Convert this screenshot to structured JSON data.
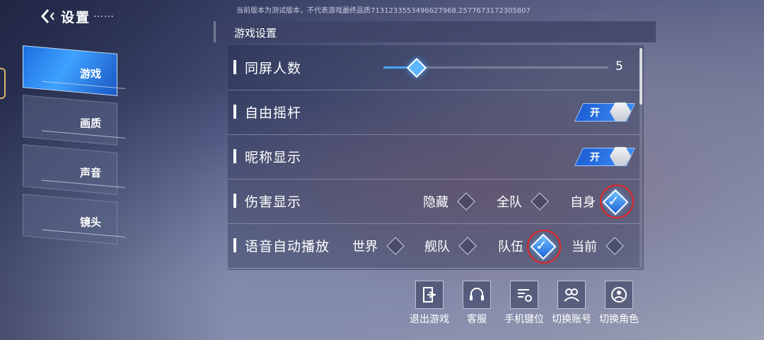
{
  "header": {
    "title": "设置",
    "dots": "……",
    "version_notice": "当前版本为测试版本，不代表游戏最终品质7131233553496627968.2577673172305807"
  },
  "tabs": [
    {
      "label": "游戏",
      "active": true
    },
    {
      "label": "画质",
      "active": false
    },
    {
      "label": "声音",
      "active": false
    },
    {
      "label": "镜头",
      "active": false
    }
  ],
  "section_title": "游戏设置",
  "settings": {
    "screen_people": {
      "label": "同屏人数",
      "value": "5",
      "level": 0.14
    },
    "free_joystick": {
      "label": "自由摇杆",
      "toggle_label": "开"
    },
    "nickname_display": {
      "label": "昵称显示",
      "toggle_label": "开"
    },
    "damage_display": {
      "label": "伤害显示",
      "options": [
        "隐藏",
        "全队",
        "自身"
      ],
      "selected": "自身"
    },
    "voice_autoplay": {
      "label": "语音自动播放",
      "options": [
        "世界",
        "舰队",
        "队伍",
        "当前"
      ],
      "selected": "队伍"
    }
  },
  "bottom_buttons": [
    "退出游戏",
    "客服",
    "手机键位",
    "切换账号",
    "切换角色"
  ],
  "colors": {
    "accent": "#3b8cf4",
    "highlight_ring": "#e0262b"
  }
}
